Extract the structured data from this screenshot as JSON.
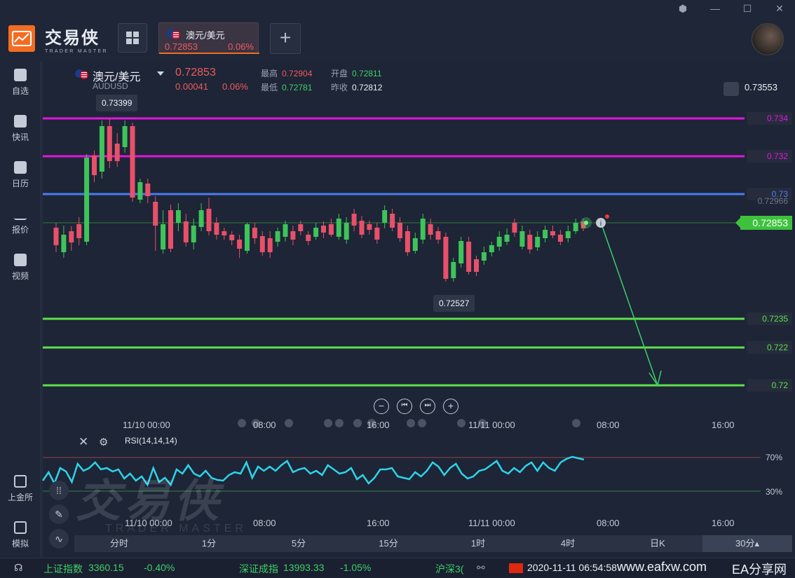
{
  "window": {
    "controls": [
      "⬢",
      "—",
      "☐",
      "✕"
    ]
  },
  "brand": {
    "name_cn": "交易侠",
    "name_en": "TRADER MASTER"
  },
  "tab": {
    "name": "澳元/美元",
    "price": "0.72853",
    "change_pct": "0.06%"
  },
  "sidebar": {
    "items": [
      {
        "label": "自选",
        "icon": "star-icon"
      },
      {
        "label": "快讯",
        "icon": "news-icon"
      },
      {
        "label": "日历",
        "icon": "calendar-icon"
      },
      {
        "label": "报价",
        "icon": "quote-icon"
      },
      {
        "label": "视频",
        "icon": "video-icon"
      },
      {
        "label": "上金所",
        "icon": "gold-exchange-icon"
      },
      {
        "label": "模拟",
        "icon": "wallet-icon"
      }
    ]
  },
  "symbol": {
    "name": "澳元/美元",
    "code": "AUDUSD",
    "price": "0.72853",
    "change": "0.00041",
    "change_pct": "0.06%",
    "high_label": "最高",
    "high": "0.72904",
    "open_label": "开盘",
    "open": "0.72811",
    "low_label": "最低",
    "low": "0.72781",
    "prev_label": "昨收",
    "prev": "0.72812"
  },
  "alert_price": "0.73553",
  "price_levels": [
    {
      "label": "0.734",
      "color": "#e514e0"
    },
    {
      "label": "0.732",
      "color": "#e514e0"
    },
    {
      "label": "0.73",
      "color": "#4a7df0"
    },
    {
      "label": "0.7235",
      "color": "#5ee04a"
    },
    {
      "label": "0.722",
      "color": "#5ee04a"
    },
    {
      "label": "0.72",
      "color": "#5ee04a"
    }
  ],
  "ghost_label": "0.72966",
  "current_price": "0.72853",
  "tooltips": {
    "high": "0.73399",
    "low": "0.72527"
  },
  "nav_buttons": [
    "−",
    "⏮",
    "⏭",
    "+"
  ],
  "xaxis_main": [
    "11/10 00:00",
    "08:00",
    "16:00",
    "11/11 00:00",
    "08:00",
    "16:00"
  ],
  "xaxis_rsi": [
    "11/10 00:00",
    "08:00",
    "16:00",
    "11/11 00:00",
    "08:00",
    "16:00"
  ],
  "rsi": {
    "title": "RSI(14,14,14)",
    "upper": "70%",
    "lower": "30%"
  },
  "periods": [
    "分时",
    "1分",
    "5分",
    "15分",
    "1时",
    "4时",
    "日K",
    "30分▴"
  ],
  "status": {
    "idx1_name": "上证指数",
    "idx1_val": "3360.15",
    "idx1_chg": "-0.40%",
    "idx2_name": "深证成指",
    "idx2_val": "13993.33",
    "idx2_chg": "-1.05%",
    "idx3_name": "沪深3(",
    "datetime": "2020-11-11 06:54:58",
    "site": "www.eafxw.com",
    "site2": "EA分享网"
  }
}
